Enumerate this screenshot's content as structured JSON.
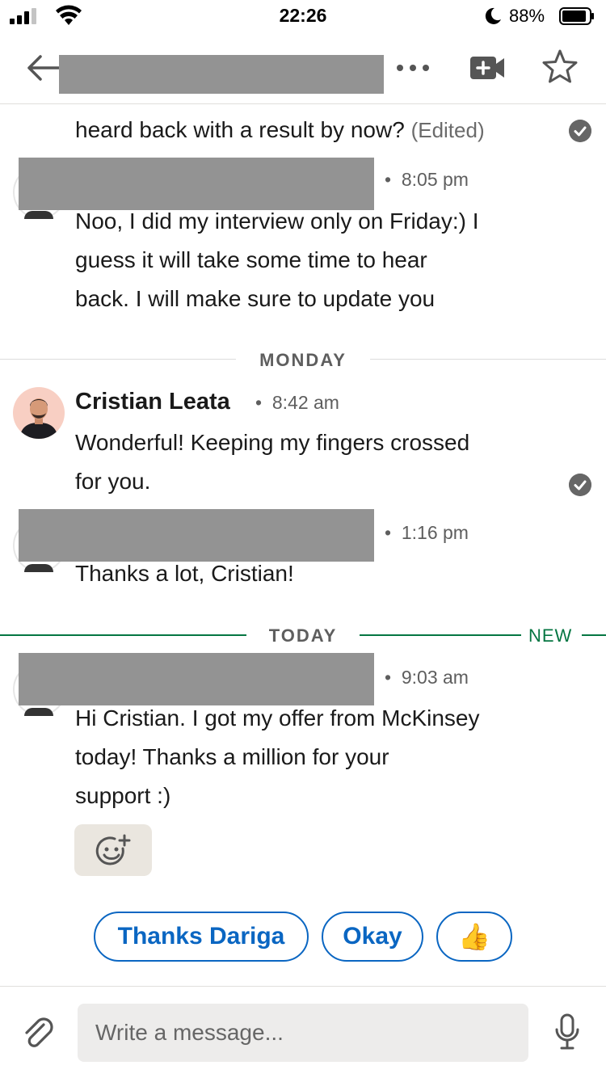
{
  "status_bar": {
    "time": "22:26",
    "battery": "88%"
  },
  "header": {
    "more_label": "•••"
  },
  "messages": [
    {
      "text": "heard back with a result by now?",
      "edited": "(Edited)"
    },
    {
      "time": "8:05 pm",
      "text": [
        "Noo, I did my interview only on Friday:) I",
        "guess it will take some time to hear",
        "back. I will make sure to update you"
      ]
    },
    {
      "day": "MONDAY"
    },
    {
      "name": "Cristian Leata",
      "time": "8:42 am",
      "text": [
        "Wonderful! Keeping my fingers crossed",
        "for you."
      ]
    },
    {
      "time": "1:16 pm",
      "text": [
        "Thanks a lot, Cristian!"
      ]
    },
    {
      "day": "TODAY",
      "new_label": "NEW"
    },
    {
      "time": "9:03 am",
      "text": [
        "Hi Cristian. I got my offer from McKinsey",
        "today! Thanks a million for your",
        "support :)"
      ]
    }
  ],
  "quick_replies": [
    "Thanks Dariga",
    "Okay",
    "👍"
  ],
  "compose": {
    "placeholder": "Write a message..."
  },
  "colors": {
    "accent": "#0a66c2",
    "new_green": "#057642",
    "redaction": "#939393"
  }
}
